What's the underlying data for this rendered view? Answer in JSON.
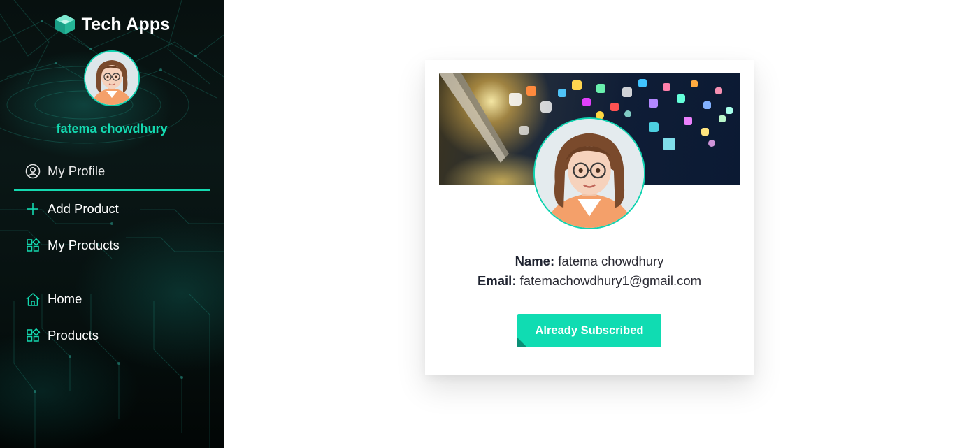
{
  "brand": {
    "name": "Tech Apps",
    "icon": "cube-logo-icon"
  },
  "user": {
    "display_name": "fatema chowdhury"
  },
  "sidebar": {
    "items": [
      {
        "label": "My Profile",
        "icon": "user-circle-icon",
        "active": true
      },
      {
        "label": "Add Product",
        "icon": "plus-icon"
      },
      {
        "label": "My Products",
        "icon": "grid-icon"
      },
      {
        "label": "Home",
        "icon": "home-icon"
      },
      {
        "label": "Products",
        "icon": "grid-icon"
      }
    ]
  },
  "profile": {
    "name_label": "Name:",
    "name_value": "fatema chowdhury",
    "email_label": "Email:",
    "email_value": "fatemachowdhury1@gmail.com",
    "button_label": "Already Subscribed"
  },
  "colors": {
    "accent": "#10dcb2",
    "sidebar_bg": "#07100f",
    "text_dark": "#2a2a33"
  }
}
